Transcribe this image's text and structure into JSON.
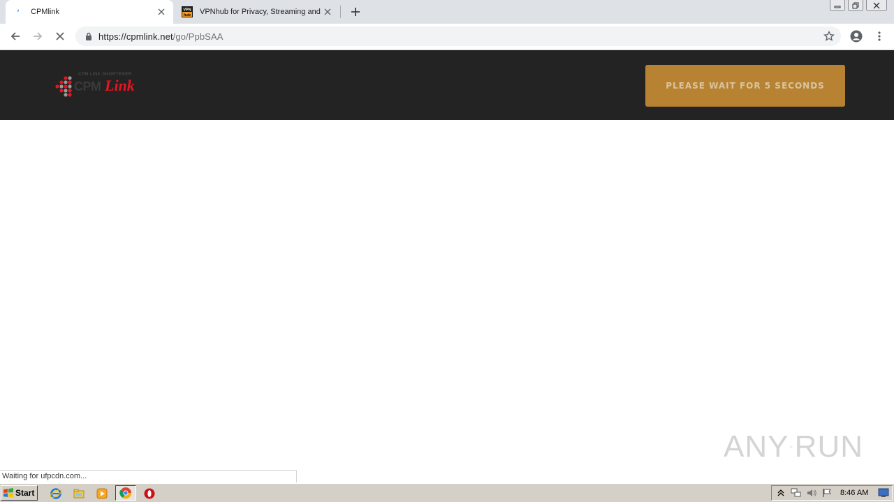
{
  "browser": {
    "tabs": [
      {
        "title": "CPMlink",
        "active": true,
        "favicon": "cpmlink-favicon"
      },
      {
        "title": "VPNhub for Privacy, Streaming and Pri",
        "active": false,
        "favicon": "vpnhub-favicon",
        "favicon_text_top": "VPN",
        "favicon_text_bottom": "hub"
      }
    ],
    "url_host": "https://cpmlink.net",
    "url_path": "/go/PpbSAA",
    "loading": true
  },
  "page": {
    "logo": {
      "primary": "CPM",
      "secondary": "Link",
      "tagline": "CPM LINK SHORTENER"
    },
    "wait_button_label": "PLEASE WAIT FOR 5 SECONDS"
  },
  "status_text": "Waiting for ufpcdn.com...",
  "watermark": {
    "left": "ANY",
    "right": "RUN"
  },
  "taskbar": {
    "start_label": "Start",
    "clock": "8:46 AM",
    "pinned": [
      "internet-explorer-icon",
      "file-explorer-icon",
      "media-player-icon",
      "chrome-icon",
      "opera-icon"
    ]
  },
  "colors": {
    "header_bg": "#232323",
    "wait_button_bg": "#b78332",
    "logo_red": "#e8141f"
  }
}
